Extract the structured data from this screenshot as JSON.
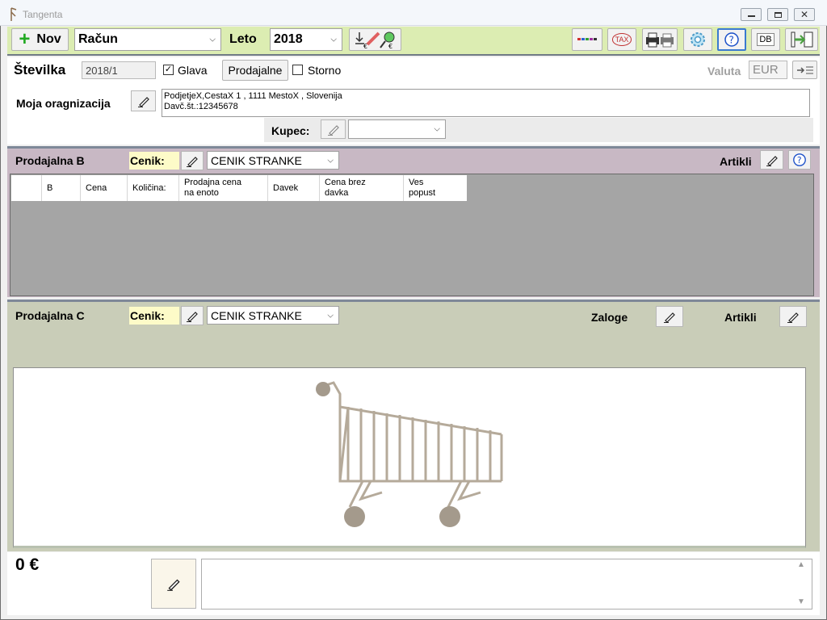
{
  "window": {
    "title": "Tangenta"
  },
  "toolbar": {
    "new_label": "Nov",
    "doc_type_value": "Račun",
    "year_label": "Leto",
    "year_value": "2018",
    "tax_label": "TAX",
    "db_label": "DB"
  },
  "header": {
    "number_label": "Številka",
    "number_value": "2018/1",
    "glava_label": "Glava",
    "glava_checked": true,
    "prodajalne_label": "Prodajalne",
    "storno_label": "Storno",
    "storno_checked": false,
    "currency_label": "Valuta",
    "currency_value": "EUR",
    "org_label": "Moja oragnizacija",
    "org_line1": "PodjetjeX,CestaX 1 , 1111 MestoX , Slovenija",
    "org_line2": "Davč.št.:12345678",
    "customer_label": "Kupec:"
  },
  "section_b": {
    "title": "Prodajalna B",
    "pricelist_label": "Cenik:",
    "pricelist_value": "CENIK STRANKE",
    "articles_label": "Artikli",
    "columns": [
      "",
      "B",
      "Cena",
      "Količina:",
      "Prodajna cena\nna enoto",
      "Davek",
      "Cena brez\ndavka",
      "Ves\npopust"
    ]
  },
  "section_c": {
    "title": "Prodajalna C",
    "pricelist_label": "Cenik:",
    "pricelist_value": "CENIK STRANKE",
    "stock_label": "Zaloge",
    "articles_label": "Artikli"
  },
  "footer": {
    "total": "0 €"
  },
  "colors": {
    "toolbar_bg": "#dcedb2",
    "section_b_bg": "#c8b8c4",
    "section_c_bg": "#c9cdb8",
    "grid_bg": "#a5a5a5",
    "cenik_highlight": "#fdfbc8",
    "accent_green": "#22aa22",
    "help_blue": "#1a4fc8"
  }
}
